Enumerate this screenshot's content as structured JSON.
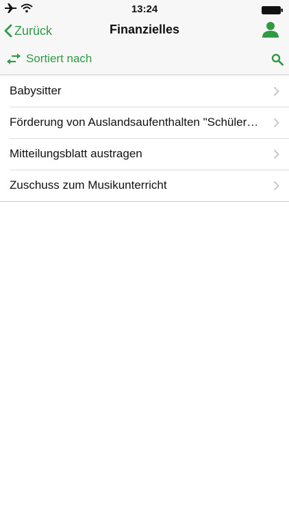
{
  "status_bar": {
    "time": "13:24",
    "icons": [
      "airplane-icon",
      "wifi-icon",
      "battery-icon"
    ]
  },
  "nav_bar": {
    "back_label": "Zurück",
    "title": "Finanzielles",
    "right_icon": "person-icon"
  },
  "toolbar": {
    "sort_label": "Sortiert nach",
    "sort_icon": "swap-arrows-icon",
    "search_icon": "search-icon"
  },
  "list": {
    "items": [
      {
        "label": "Babysitter"
      },
      {
        "label": "Förderung von Auslandsaufenthalten \"Schüleraustausch\""
      },
      {
        "label": "Mitteilungsblatt austragen"
      },
      {
        "label": "Zuschuss zum Musikunterricht"
      }
    ]
  },
  "colors": {
    "accent": "#2e9a43",
    "bar_background": "#f7f7f7",
    "separator": "#c8c8cc",
    "chevron": "#c7c7cc"
  }
}
